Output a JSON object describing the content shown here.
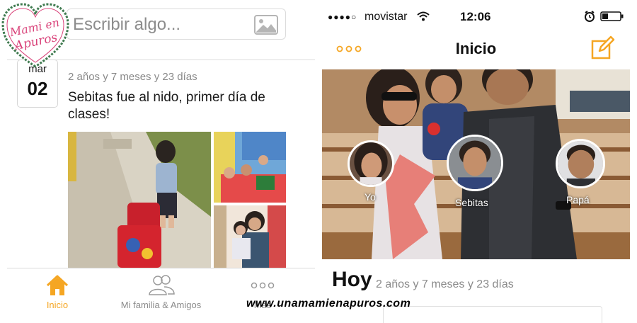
{
  "logo": {
    "line1": "Mami en",
    "line2": "Apuros"
  },
  "feed": {
    "compose_placeholder": "Escribir algo...",
    "date_month": "mar",
    "date_day": "02",
    "age": "2 años y 7 meses y 23 días",
    "post_text": "Sebitas fue al nido, primer día de clases!"
  },
  "tabbar": {
    "tabs": [
      {
        "label": "Inicio",
        "icon": "home-icon",
        "active": true
      },
      {
        "label": "Mi familia & Amigos",
        "icon": "people-icon",
        "active": false
      },
      {
        "label": "Más",
        "icon": "more-dots-icon",
        "active": false
      }
    ]
  },
  "status": {
    "carrier": "movistar",
    "time": "12:06",
    "signal": "●●●●○"
  },
  "nav": {
    "title": "Inicio"
  },
  "people": [
    {
      "name": "Yo"
    },
    {
      "name": "Sebitas"
    },
    {
      "name": "Papá"
    }
  ],
  "summary": {
    "heading": "Hoy",
    "age": "2 años y 7 meses y 23 días"
  },
  "watermark": "www.unamamienapuros.com",
  "colors": {
    "accent": "#f5a623",
    "muted_text": "#8a8a8a"
  }
}
